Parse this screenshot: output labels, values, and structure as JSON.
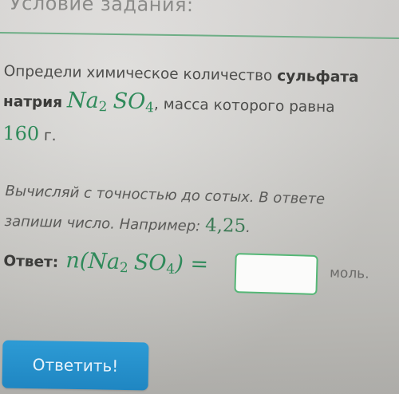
{
  "section": {
    "title": "Условие задания:"
  },
  "task": {
    "prefix": "Определи химическое количество",
    "substance": "сульфата",
    "line2_word": "натрия",
    "formula_part1": "Na",
    "formula_sub1": "2",
    "formula_part2": "SO",
    "formula_sub2": "4",
    "line2_suffix": ", масса которого равна",
    "mass_value": "160",
    "mass_unit": "г."
  },
  "hint": {
    "line1": "Вычисляй с точностью до сотых. В ответе",
    "line2_prefix": "запиши число. Например:",
    "example": "4,25",
    "line2_suffix": "."
  },
  "answer": {
    "label": "Ответ:",
    "formula_n": "n(",
    "formula_part1": "Na",
    "formula_sub1": "2",
    "formula_part2": "SO",
    "formula_sub2": "4",
    "formula_close": ") =",
    "input_value": "",
    "unit": "моль."
  },
  "submit": {
    "label": "Ответить!"
  },
  "colors": {
    "accent_green": "#55b776",
    "button_blue": "#2d9bd5",
    "formula_green": "#2f8a5a"
  }
}
